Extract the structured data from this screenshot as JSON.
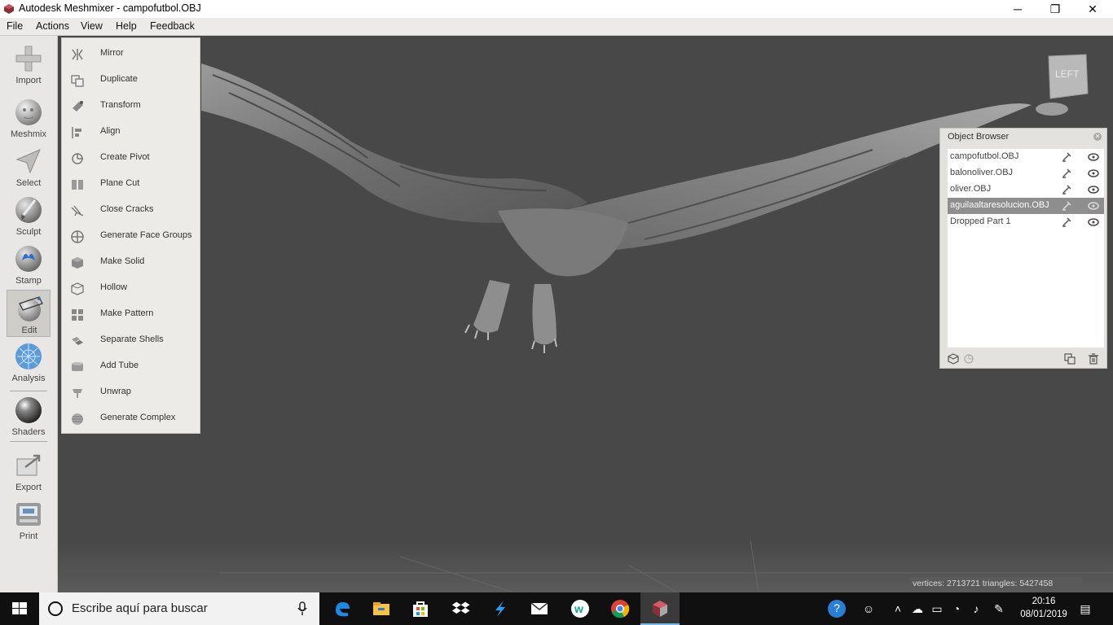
{
  "window": {
    "title": "Autodesk Meshmixer - campofutbol.OBJ",
    "minimize_glyph": "─",
    "restore_glyph": "❐",
    "close_glyph": "✕"
  },
  "menubar": {
    "items": [
      "File",
      "Actions",
      "View",
      "Help",
      "Feedback"
    ]
  },
  "toolbar": {
    "tools": [
      {
        "label": "Import",
        "icon": "plus-icon"
      },
      {
        "label": "Meshmix",
        "icon": "face-sphere-icon"
      },
      {
        "label": "Select",
        "icon": "arrow-select-icon"
      },
      {
        "label": "Sculpt",
        "icon": "brush-icon"
      },
      {
        "label": "Stamp",
        "icon": "stamp-icon"
      },
      {
        "label": "Edit",
        "icon": "edit-sphere-icon"
      },
      {
        "label": "Analysis",
        "icon": "mesh-sphere-icon"
      },
      {
        "label": "Shaders",
        "icon": "shader-sphere-icon"
      },
      {
        "label": "Export",
        "icon": "export-icon"
      },
      {
        "label": "Print",
        "icon": "printer-icon"
      }
    ],
    "active": "Edit"
  },
  "edit_menu": {
    "items": [
      {
        "label": "Mirror",
        "icon": "mirror-icon"
      },
      {
        "label": "Duplicate",
        "icon": "duplicate-icon"
      },
      {
        "label": "Transform",
        "icon": "transform-icon"
      },
      {
        "label": "Align",
        "icon": "align-icon"
      },
      {
        "label": "Create Pivot",
        "icon": "pivot-icon"
      },
      {
        "label": "Plane Cut",
        "icon": "plane-cut-icon"
      },
      {
        "label": "Close Cracks",
        "icon": "close-cracks-icon"
      },
      {
        "label": "Generate Face Groups",
        "icon": "face-groups-icon"
      },
      {
        "label": "Make Solid",
        "icon": "make-solid-icon"
      },
      {
        "label": "Hollow",
        "icon": "hollow-icon"
      },
      {
        "label": "Make Pattern",
        "icon": "pattern-icon"
      },
      {
        "label": "Separate Shells",
        "icon": "shells-icon"
      },
      {
        "label": "Add Tube",
        "icon": "tube-icon"
      },
      {
        "label": "Unwrap",
        "icon": "unwrap-icon"
      },
      {
        "label": "Generate Complex",
        "icon": "complex-icon"
      }
    ]
  },
  "viewcube": {
    "label": "LEFT"
  },
  "object_browser": {
    "title": "Object Browser",
    "objects": [
      {
        "name": "campofutbol.OBJ",
        "selected": false
      },
      {
        "name": "balonoliver.OBJ",
        "selected": false
      },
      {
        "name": "oliver.OBJ",
        "selected": false
      },
      {
        "name": "aguilaaltaresolucion.OBJ",
        "selected": true
      },
      {
        "name": "Dropped Part 1",
        "selected": false
      }
    ]
  },
  "status": {
    "text": "vertices: 2713721 triangles: 5427458"
  },
  "taskbar": {
    "search_placeholder": "Escribe aquí para buscar",
    "apps": [
      "edge-icon",
      "file-explorer-icon",
      "store-icon",
      "dropbox-icon",
      "app-blue-icon",
      "mail-icon",
      "wattpad-icon",
      "chrome-icon",
      "meshmixer-icon"
    ],
    "time": "20:16",
    "date": "08/01/2019"
  },
  "colors": {
    "viewport": "#484848",
    "panel": "#edebe8",
    "selected_row": "#8e8e8e",
    "taskbar": "#101010",
    "taskbar_accent": "#76b9ed"
  }
}
